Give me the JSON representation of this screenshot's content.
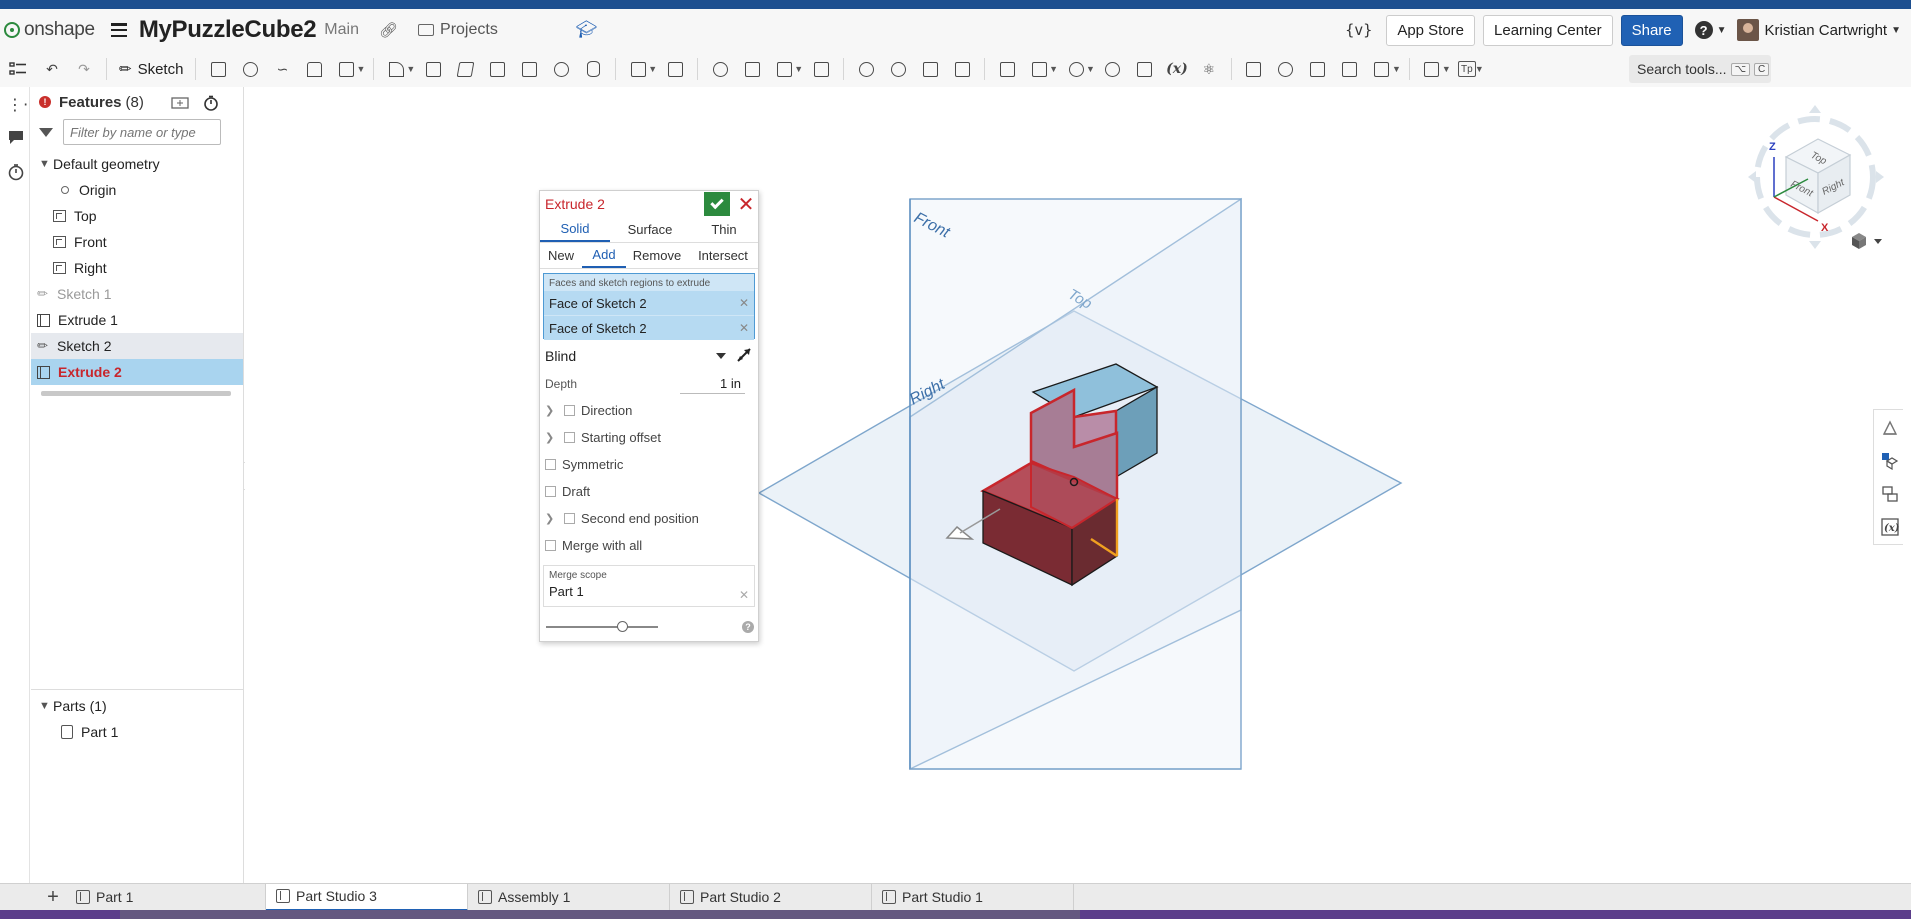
{
  "header": {
    "logo_text": "onshape",
    "document_title": "MyPuzzleCube2",
    "branch": "Main",
    "projects_label": "Projects",
    "variables_icon_text": "{v}",
    "app_store": "App Store",
    "learning_center": "Learning Center",
    "share": "Share",
    "help_glyph": "?",
    "user_name": "Kristian Cartwright"
  },
  "toolbar": {
    "sketch_label": "Sketch",
    "tp_label": "Tp",
    "search_tools": "Search tools...",
    "search_kbd_1": "⌥",
    "search_kbd_2": "C"
  },
  "feature_panel": {
    "title": "Features",
    "count": "(8)",
    "filter_placeholder": "Filter by name or type",
    "default_geometry": "Default geometry",
    "items": [
      {
        "label": "Origin"
      },
      {
        "label": "Top"
      },
      {
        "label": "Front"
      },
      {
        "label": "Right"
      },
      {
        "label": "Sketch 1"
      },
      {
        "label": "Extrude 1"
      },
      {
        "label": "Sketch 2"
      },
      {
        "label": "Extrude 2"
      }
    ],
    "parts_title": "Parts (1)",
    "parts": [
      {
        "label": "Part 1"
      }
    ]
  },
  "dialog": {
    "title": "Extrude 2",
    "body_types": [
      "Solid",
      "Surface",
      "Thin"
    ],
    "operations": [
      "New",
      "Add",
      "Remove",
      "Intersect"
    ],
    "selection_label": "Faces and sketch regions to extrude",
    "selections": [
      "Face of Sketch 2",
      "Face of Sketch 2"
    ],
    "end_type": "Blind",
    "depth_label": "Depth",
    "depth_value": "1 in",
    "direction": "Direction",
    "starting_offset": "Starting offset",
    "symmetric": "Symmetric",
    "draft": "Draft",
    "second_end": "Second end position",
    "merge_with_all": "Merge with all",
    "merge_scope_label": "Merge scope",
    "merge_scope_value": "Part 1",
    "help_glyph": "?"
  },
  "viewport": {
    "plane_front": "Front",
    "plane_top": "Top",
    "plane_right": "Right"
  },
  "viewcube": {
    "face_top": "Top",
    "face_front": "Front",
    "face_right": "Right",
    "axis_z": "Z",
    "axis_x": "X"
  },
  "tabs": [
    {
      "label": "Part 1"
    },
    {
      "label": "Part Studio 3"
    },
    {
      "label": "Assembly 1"
    },
    {
      "label": "Part Studio 2"
    },
    {
      "label": "Part Studio 1"
    }
  ],
  "colors": {
    "accent_blue": "#2061b4",
    "feature_red": "#c8262c",
    "confirm_green": "#2c8a3e",
    "selection_bg": "#a9d4ef"
  }
}
